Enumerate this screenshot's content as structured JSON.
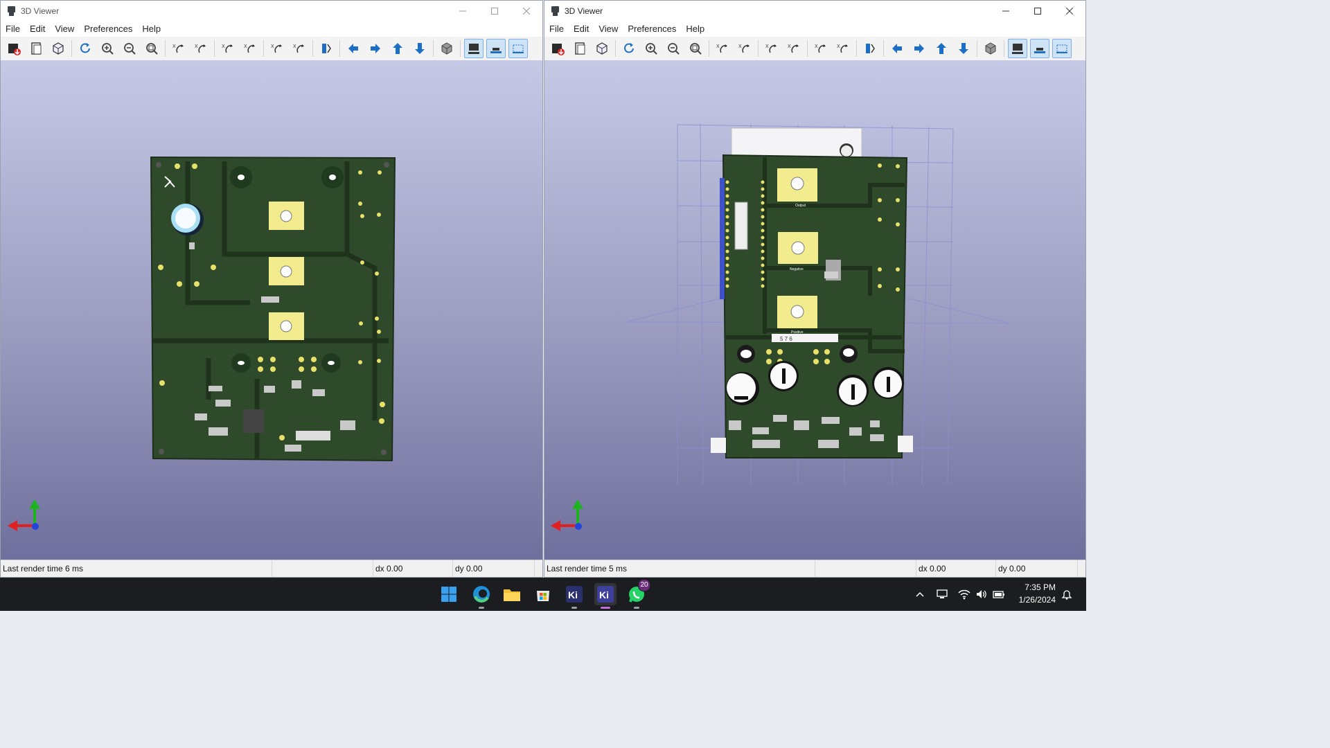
{
  "windows": [
    {
      "title": "3D Viewer",
      "menu": [
        "File",
        "Edit",
        "View",
        "Preferences",
        "Help"
      ],
      "status": {
        "render_time": "Last render time 6 ms",
        "dx": "dx 0.00",
        "dy": "dy 0.00"
      }
    },
    {
      "title": "3D Viewer",
      "menu": [
        "File",
        "Edit",
        "View",
        "Preferences",
        "Help"
      ],
      "status": {
        "render_time": "Last render time 5 ms",
        "dx": "dx 0.00",
        "dy": "dy 0.00"
      }
    }
  ],
  "toolbar_icons": [
    "export-image-icon",
    "copy-clipboard-icon",
    "raytrace-icon",
    "reload-icon",
    "zoom-in-icon",
    "zoom-out-icon",
    "zoom-fit-icon",
    "rotate-x-cw-icon",
    "rotate-x-ccw-icon",
    "rotate-y-cw-icon",
    "rotate-y-ccw-icon",
    "rotate-z-cw-icon",
    "rotate-z-ccw-icon",
    "flip-board-icon",
    "pan-left-icon",
    "pan-right-icon",
    "pan-up-icon",
    "pan-down-icon",
    "ortho-toggle-icon",
    "show-tht-icon",
    "show-smd-icon",
    "show-virtual-icon"
  ],
  "board_silkscreen": {
    "pad1": "Output",
    "pad2": "Negative",
    "pad3": "Positive",
    "strip": "5   7   6"
  },
  "taskbar": {
    "whatsapp_badge": "20",
    "time": "7:35 PM",
    "date": "1/26/2024"
  },
  "colors": {
    "pcb": "#2e4a2b",
    "pad_gold": "#f3ec8e",
    "viewport_top": "#c6c9e6",
    "viewport_bottom": "#6f6f9d"
  }
}
